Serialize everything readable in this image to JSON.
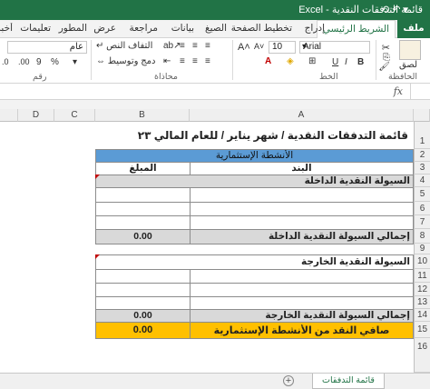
{
  "window": {
    "title": "قائمة التدفقات النقدية  -  Excel",
    "qa": "⟲  ↶  ▾"
  },
  "tabs": {
    "file": "ملف",
    "home": "الشريط الرئيسي",
    "insert": "إدراج",
    "layout": "تخطيط الصفحة",
    "formulas": "الصيغ",
    "data": "بيانات",
    "review": "مراجعة",
    "view": "عرض",
    "developer": "المطور",
    "help": "تعليمات",
    "tell": "أخبرني بما تريد"
  },
  "ribbon": {
    "paste": "لصق",
    "clipboard": "الحافظة",
    "font_name": "Arial",
    "font_size": "10",
    "font_group": "الخط",
    "wrap": "التفاف النص",
    "merge": "دمج وتوسيط",
    "align_group": "محاذاة",
    "number_format": "عام",
    "number_group": "رقم"
  },
  "formula_bar": {
    "fx": "fx"
  },
  "columns": [
    "A",
    "B",
    "C",
    "D"
  ],
  "rows": [
    "1",
    "2",
    "3",
    "4",
    "5",
    "6",
    "7",
    "8",
    "9",
    "10",
    "11",
    "12",
    "13",
    "14",
    "15",
    "16"
  ],
  "sheet": {
    "title": "قائمة التدفقات النقدية / شهر يناير / للعام المالي ٢٠٢٣",
    "section": "الأنشطة الإستثمارية",
    "col_item": "البند",
    "col_amount": "المبلغ",
    "inflow_header": "السيولة النقدية الداخلة",
    "inflow_total_label": "إجمالي السيولة النقدية الداخلة",
    "inflow_total": "0.00",
    "outflow_header": "السيولة النقدية الخارجة",
    "outflow_total_label": "إجمالي السيولة النقدية الخارجة",
    "outflow_total": "0.00",
    "net_label": "صافي النقد من الأنشطة الإستثمارية",
    "net_value": "0.00"
  },
  "sheet_tabs": {
    "active": "قائمة التدفقات النقدية",
    "add": "+"
  },
  "colors": {
    "excel_green": "#217346",
    "section_blue": "#5b9bd5",
    "net_gold": "#ffc000",
    "total_gray": "#d9d9d9"
  }
}
